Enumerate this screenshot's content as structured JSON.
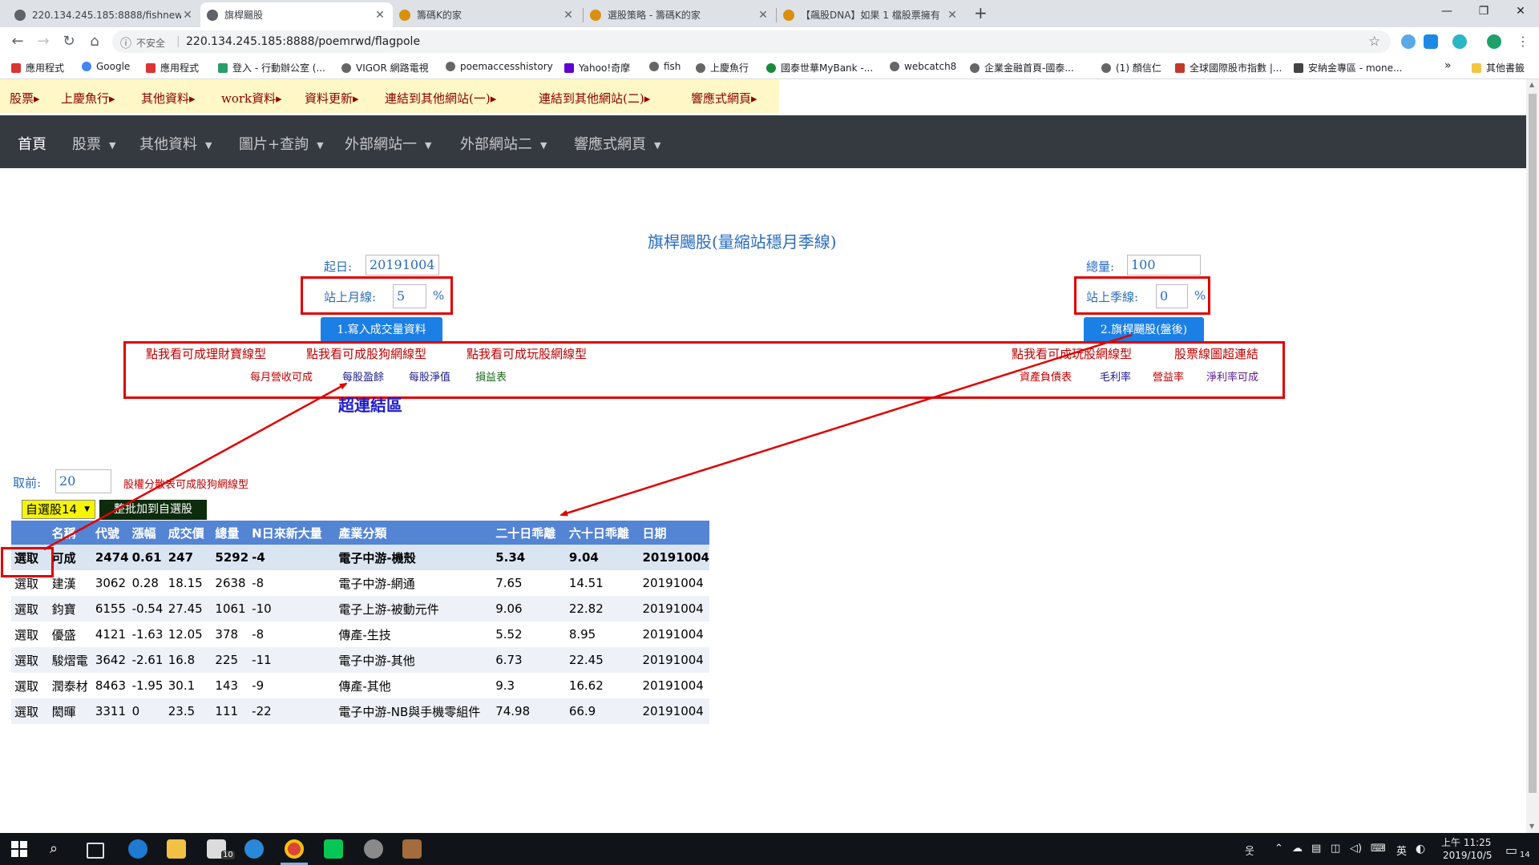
{
  "browser": {
    "tabs": [
      {
        "title": "220.134.245.185:8888/fishnew"
      },
      {
        "title": "旗桿颺股"
      },
      {
        "title": "籌碼K的家"
      },
      {
        "title": "選股策略 - 籌碼K的家"
      },
      {
        "title": "【飆股DNA】如果 1 檔股票擁有"
      }
    ],
    "new_tab": "+",
    "security_label": "不安全",
    "url": "220.134.245.185:8888/poemrwd/flagpole",
    "bookmarks": [
      "應用程式",
      "Google",
      "應用程式",
      "登入 - 行動辦公室 (...",
      "VIGOR 網路電視",
      "poemaccesshistory",
      "Yahoo!奇摩",
      "fish",
      "上慶魚行",
      "國泰世華MyBank -...",
      "webcatch8",
      "企業金融首頁-國泰...",
      "(1) 顏信仁",
      "全球國際股市指數 |...",
      "安納金專區 - mone..."
    ],
    "bookmarks_more": "»",
    "other_bookmarks": "其他書籤"
  },
  "top_menu": [
    "股票▸",
    "上慶魚行▸",
    "其他資料▸",
    "work資料▸",
    "資料更新▸",
    "連結到其他網站(一)▸",
    "連結到其他網站(二)▸",
    "響應式網頁▸"
  ],
  "navbar": {
    "home": "首頁",
    "items": [
      "股票",
      "其他資料",
      "圖片+查詢",
      "外部網站一",
      "外部網站二",
      "響應式網頁"
    ]
  },
  "page": {
    "title": "旗桿颺股(量縮站穩月季線)",
    "start_date_label": "起日:",
    "start_date_value": "20191004",
    "volume_label": "總量:",
    "volume_value": "100",
    "month_line_label": "站上月線:",
    "month_line_value": "5",
    "quarter_line_label": "站上季線:",
    "quarter_line_value": "0",
    "percent": "%",
    "btn_write": "1.寫入成交量資料",
    "btn_flagpole": "2.旗桿颺股(盤後)",
    "links_row1_left": [
      "點我看可成理財寶線型",
      "點我看可成股狗網線型",
      "點我看可成玩股網線型"
    ],
    "links_row1_right": [
      "點我看可成玩股網線型",
      "股票線圖超連結"
    ],
    "links_row2_left": [
      "每月營收可成",
      "每股盈餘",
      "每股淨值",
      "損益表"
    ],
    "links_row2_right": [
      "資產負債表",
      "毛利率",
      "營益率",
      "淨利率可成"
    ],
    "annotation": "超連結區",
    "take_label": "取前:",
    "take_value": "20",
    "holding_link": "股權分散表可成股狗網線型",
    "watchlist_select": "自選股14",
    "batch_add_button": "整批加到自選股"
  },
  "colors": {
    "link_red": "#c00000",
    "link_navy": "#1a1a8c",
    "link_green": "#1a6b1a",
    "annotation_blue": "#1c1ccf",
    "header_blue": "#5484d4"
  },
  "table": {
    "headers": [
      "",
      "名稱",
      "代號",
      "漲幅",
      "成交價",
      "總量",
      "N日來新大量",
      "產業分類",
      "二十日乖離",
      "六十日乖離",
      "日期"
    ],
    "rows": [
      [
        "選取",
        "可成",
        "2474",
        "0.61",
        "247",
        "5292",
        "-4",
        "電子中游-機殼",
        "5.34",
        "9.04",
        "20191004"
      ],
      [
        "選取",
        "建漢",
        "3062",
        "0.28",
        "18.15",
        "2638",
        "-8",
        "電子中游-網通",
        "7.65",
        "14.51",
        "20191004"
      ],
      [
        "選取",
        "鈞寶",
        "6155",
        "-0.54",
        "27.45",
        "1061",
        "-10",
        "電子上游-被動元件",
        "9.06",
        "22.82",
        "20191004"
      ],
      [
        "選取",
        "優盛",
        "4121",
        "-1.63",
        "12.05",
        "378",
        "-8",
        "傳產-生技",
        "5.52",
        "8.95",
        "20191004"
      ],
      [
        "選取",
        "駿熠電",
        "3642",
        "-2.61",
        "16.8",
        "225",
        "-11",
        "電子中游-其他",
        "6.73",
        "22.45",
        "20191004"
      ],
      [
        "選取",
        "潤泰材",
        "8463",
        "-1.95",
        "30.1",
        "143",
        "-9",
        "傳產-其他",
        "9.3",
        "16.62",
        "20191004"
      ],
      [
        "選取",
        "閎暉",
        "3311",
        "0",
        "23.5",
        "111",
        "-22",
        "電子中游-NB與手機零組件",
        "74.98",
        "66.9",
        "20191004"
      ]
    ]
  },
  "taskbar": {
    "mail_badge": "10",
    "ime": "英",
    "time": "上午 11:25",
    "date": "2019/10/5",
    "notifications": "14"
  }
}
